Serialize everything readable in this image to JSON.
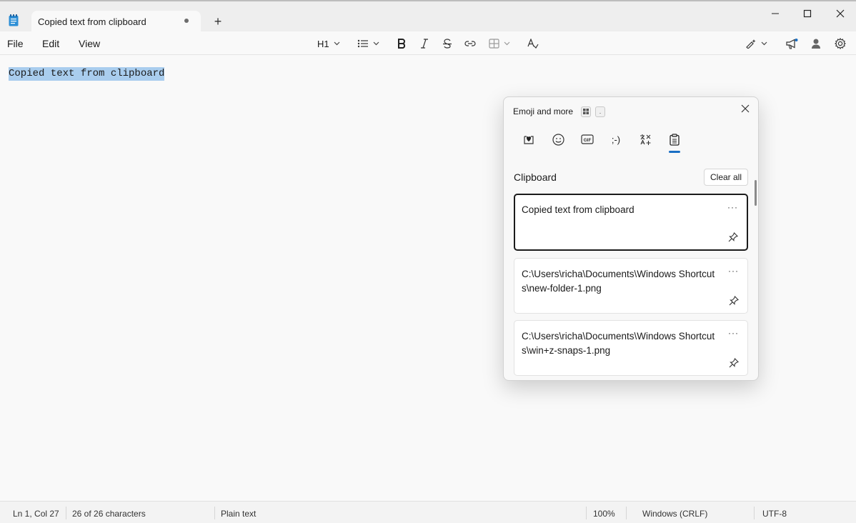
{
  "window": {
    "tab_title": "Copied text from clipboard",
    "new_tab_symbol": "+"
  },
  "menu": {
    "file": "File",
    "edit": "Edit",
    "view": "View"
  },
  "toolbar": {
    "heading_label": "H1"
  },
  "editor": {
    "content": "Copied text from clipboard",
    "selection_color": "#a9cdee"
  },
  "status": {
    "position": "Ln 1, Col 27",
    "characters": "26 of 26 characters",
    "format": "Plain text",
    "zoom": "100%",
    "line_ending": "Windows (CRLF)",
    "encoding": "UTF-8"
  },
  "emoji_panel": {
    "title": "Emoji and more",
    "categories": [
      "recent-heart-icon",
      "smiley-icon",
      "gif-icon",
      "kaomoji-icon",
      "symbols-icon",
      "clipboard-icon"
    ],
    "kaomoji_label": ";-)",
    "active_category": "clipboard",
    "accent_color": "#1a6fc4",
    "clipboard": {
      "heading": "Clipboard",
      "clear_all": "Clear all",
      "items": [
        {
          "text": "Copied text from clipboard"
        },
        {
          "text": "C:\\Users\\richa\\Documents\\Windows Shortcuts\\new-folder-1.png"
        },
        {
          "text": "C:\\Users\\richa\\Documents\\Windows Shortcuts\\win+z-snaps-1.png"
        }
      ],
      "more_symbol": "···"
    }
  }
}
